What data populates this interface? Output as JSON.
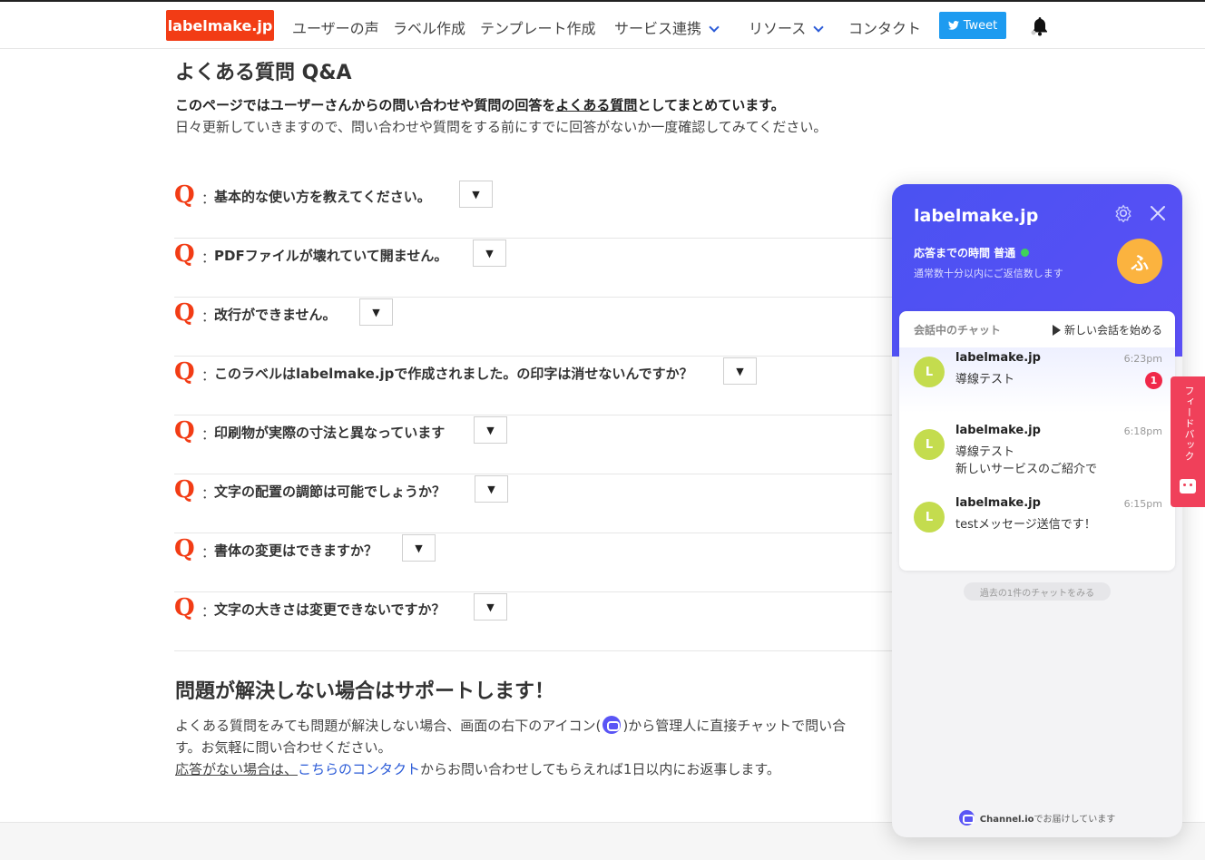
{
  "header": {
    "logo": "labelmake.jp",
    "nav": [
      "ユーザーの声",
      "ラベル作成",
      "テンプレート作成",
      "サービス連携",
      "リソース",
      "コンタクト"
    ],
    "tweet": "Tweet"
  },
  "main": {
    "title": "よくある質問 Q&A",
    "intro_bold_prefix": "このページではユーザーさんからの問い合わせや質問の回答を",
    "intro_bold_link": "よくある質問",
    "intro_bold_suffix": "としてまとめています。",
    "intro": "日々更新していきますので、問い合わせや質問をする前にすでに回答がないか一度確認してみてください。",
    "q_mark": "Q",
    "colon": "：",
    "toggle": "▼",
    "faqs": [
      "基本的な使い方を教えてください。",
      "PDFファイルが壊れていて開ません。",
      "改行ができません。",
      "このラベルはlabelmake.jpで作成されました。の印字は消せないんですか？",
      "印刷物が実際の寸法と異なっています",
      "文字の配置の調節は可能でしょうか？",
      "書体の変更はできますか？",
      "文字の大きさは変更できないですか？"
    ],
    "support_title": "問題が解決しない場合はサポートします！",
    "support_line1_a": "よくある質問をみても問題が解決しない場合、画面の右下のアイコン(",
    "support_line1_b": ")から管理人に直接チャットで問い合",
    "support_line2": "す。お気軽に問い合わせください。",
    "support_line3_a": "応答がない場合は、",
    "support_line3_link": "こちらのコンタクト",
    "support_line3_b": "からお問い合わせしてもらえれば1日以内にお返事します。"
  },
  "chat": {
    "title": "labelmake.jp",
    "response_label": "応答までの時間 普通",
    "response_sub": "通常数十分以内にご返信数します",
    "avatar": "ふ",
    "card_header": "会話中のチャット",
    "new_chat": "新しい会話を始める",
    "conversations": [
      {
        "name": "labelmake.jp",
        "time": "6:23pm",
        "msg1": "導線テスト",
        "msg2": "",
        "badge": "1",
        "avatar": "L"
      },
      {
        "name": "labelmake.jp",
        "time": "6:18pm",
        "msg1": "導線テスト",
        "msg2": "新しいサービスのご紹介で",
        "badge": "",
        "avatar": "L"
      },
      {
        "name": "labelmake.jp",
        "time": "6:15pm",
        "msg1": "testメッセージ送信です！",
        "msg2": "",
        "badge": "",
        "avatar": "L"
      }
    ],
    "past_chats": "過去の1件のチャットをみる",
    "powered_brand": "Channel.io",
    "powered_suffix": "でお届けしています"
  },
  "feedback": {
    "label": "フィードバック"
  },
  "colors": {
    "brand_red": "#f23c15",
    "chat_purple": "#4a52f2",
    "link_blue": "#2b5bd7",
    "tweet_blue": "#1d9bf0",
    "feedback_red": "#f0405a"
  }
}
